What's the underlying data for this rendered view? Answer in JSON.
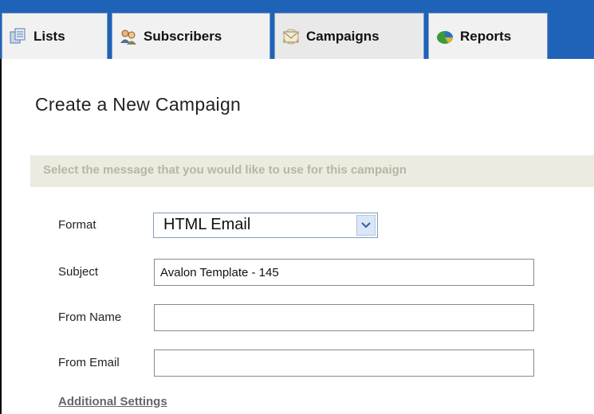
{
  "tabs": [
    {
      "label": "Lists",
      "icon": "lists-icon"
    },
    {
      "label": "Subscribers",
      "icon": "subscribers-icon"
    },
    {
      "label": "Campaigns",
      "icon": "campaigns-icon",
      "active": true
    },
    {
      "label": "Reports",
      "icon": "reports-icon"
    }
  ],
  "page": {
    "title": "Create a New Campaign",
    "section_heading": "Select the message that you would like to use for this campaign"
  },
  "form": {
    "format": {
      "label": "Format",
      "value": "HTML Email"
    },
    "subject": {
      "label": "Subject",
      "value": "Avalon Template - 145"
    },
    "from_name": {
      "label": "From Name",
      "value": ""
    },
    "from_email": {
      "label": "From Email",
      "value": ""
    }
  },
  "links": {
    "additional_settings": "Additional Settings"
  },
  "colors": {
    "tab_bar": "#1f63b8",
    "section_band": "#ecebdf",
    "section_text": "#b7b5a7"
  }
}
